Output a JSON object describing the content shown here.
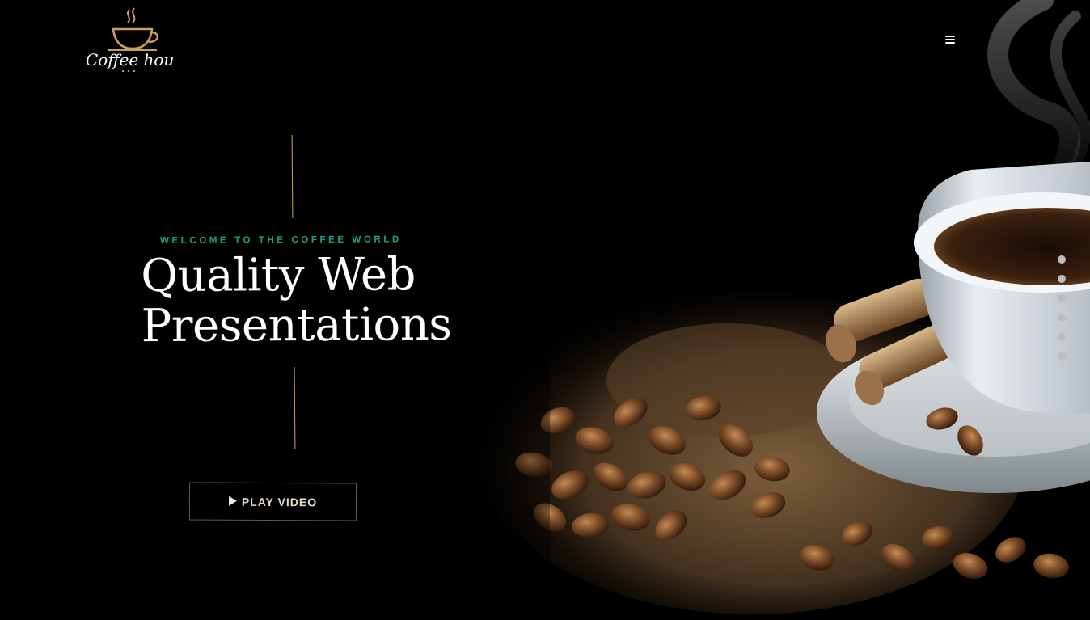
{
  "brand": {
    "name": "Coffee house",
    "accent_color": "#c9a25a"
  },
  "header": {
    "menu_icon": "hamburger-menu-icon"
  },
  "hero": {
    "eyebrow": "WELCOME TO THE COFFEE WORLD",
    "headline_line1": "Quality Web",
    "headline_line2": "Presentations",
    "eyebrow_color": "#1ba38e",
    "cta_label": "PLAY VIDEO",
    "cta_icon": "play-icon"
  },
  "slider": {
    "dot_count": 6,
    "dot_color": "#bdbdbd"
  }
}
